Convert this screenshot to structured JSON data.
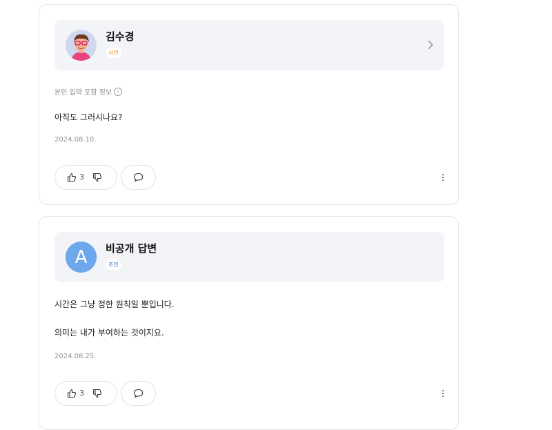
{
  "answers": [
    {
      "name": "김수경",
      "badge": "서민",
      "badge_color": "#f08a24",
      "info_label": "본인 입력 포함 정보",
      "info_icon": "info-icon",
      "lines": [
        "아직도 그러시나요?"
      ],
      "date": "2024.08.10.",
      "likes": "3",
      "avatar_type": "illustration"
    },
    {
      "name": "비공개 답변",
      "badge": "조인",
      "badge_color": "#2f6fd1",
      "avatar_letter": "A",
      "avatar_color": "#6ea8ec",
      "lines": [
        "시간은 그냥 정한 원칙일 뿐입니다.",
        "의미는 내가 부여하는 것이지요."
      ],
      "date": "2024.08.25.",
      "likes": "3",
      "avatar_type": "letter"
    }
  ],
  "icons": {
    "chevron": "chevron-right-icon",
    "like": "thumbs-up-icon",
    "dislike": "thumbs-down-icon",
    "comment": "comment-bubble-icon",
    "more": "more-vertical-icon"
  }
}
